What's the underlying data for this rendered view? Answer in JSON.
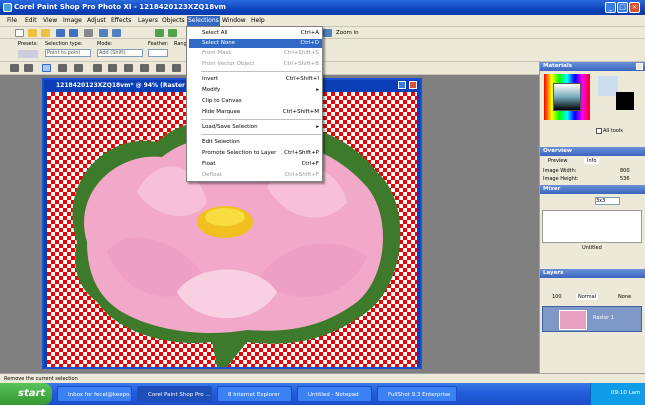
{
  "window": {
    "title": "Corel Paint Shop Pro Photo XI - 1218420123XZQ18vm"
  },
  "menu": [
    "File",
    "Edit",
    "View",
    "Image",
    "Adjust",
    "Effects",
    "Layers",
    "Objects",
    "Selections",
    "Window",
    "Help"
  ],
  "toolbar": {
    "zoom_in": "Zoom in"
  },
  "options": {
    "presets_label": "Presets:",
    "selection_type_label": "Selection type:",
    "selection_type_value": "Point to point",
    "mode_label": "Mode:",
    "mode_value": "Add (Shift)",
    "feather_label": "Feather:",
    "range_label": "Range"
  },
  "document": {
    "title": "1218420123XZQ18vm* @  94% (Raster 1)"
  },
  "selections_menu": [
    {
      "label": "Select All",
      "shortcut": "Ctrl+A",
      "state": "normal"
    },
    {
      "label": "Select None",
      "shortcut": "Ctrl+D",
      "state": "highlighted"
    },
    {
      "label": "From Mask",
      "shortcut": "Ctrl+Shift+S",
      "state": "disabled"
    },
    {
      "label": "From Vector Object",
      "shortcut": "Ctrl+Shift+B",
      "state": "disabled"
    },
    {
      "label": "Invert",
      "shortcut": "Ctrl+Shift+I",
      "state": "normal"
    },
    {
      "label": "Modify",
      "shortcut": "▸",
      "state": "normal"
    },
    {
      "label": "Clip to Canvas",
      "shortcut": "",
      "state": "normal"
    },
    {
      "label": "Hide Marquee",
      "shortcut": "Ctrl+Shift+M",
      "state": "normal"
    },
    {
      "label": "Load/Save Selection",
      "shortcut": "▸",
      "state": "normal"
    },
    {
      "label": "Edit Selection",
      "shortcut": "",
      "state": "normal"
    },
    {
      "label": "Promote Selection to Layer",
      "shortcut": "Ctrl+Shift+P",
      "state": "normal"
    },
    {
      "label": "Float",
      "shortcut": "Ctrl+F",
      "state": "normal"
    },
    {
      "label": "Defloat",
      "shortcut": "Ctrl+Shift+F",
      "state": "disabled"
    }
  ],
  "panels": {
    "materials": "Materials",
    "all_tools": "All tools",
    "overview": "Overview",
    "preview_tab": "Preview",
    "info_tab": "Info",
    "image_width_label": "Image Width:",
    "image_width": "800",
    "image_height_label": "Image Height:",
    "image_height": "536",
    "mixer": "Mixer",
    "mixer_size": "3x3",
    "untitled": "Untitled",
    "layers": "Layers",
    "opacity": "100",
    "blend": "Normal",
    "none": "None",
    "layer_name": "Raster 1"
  },
  "status": "Remove the current selection",
  "taskbar": {
    "start": "start",
    "items": [
      "Inbox for fecel@keepo...",
      "Corel Paint Shop Pro ...",
      "8 Internet Explorer",
      "Untitled - Notepad",
      "FullShot 9.3 Enterprise"
    ],
    "clock": "09:10 Lam"
  },
  "colors": {
    "selection_highlight": "#316ac5",
    "title_blue": "#0a3fb8",
    "checker_red": "#e00000",
    "taskbar_blue": "#245edb"
  }
}
